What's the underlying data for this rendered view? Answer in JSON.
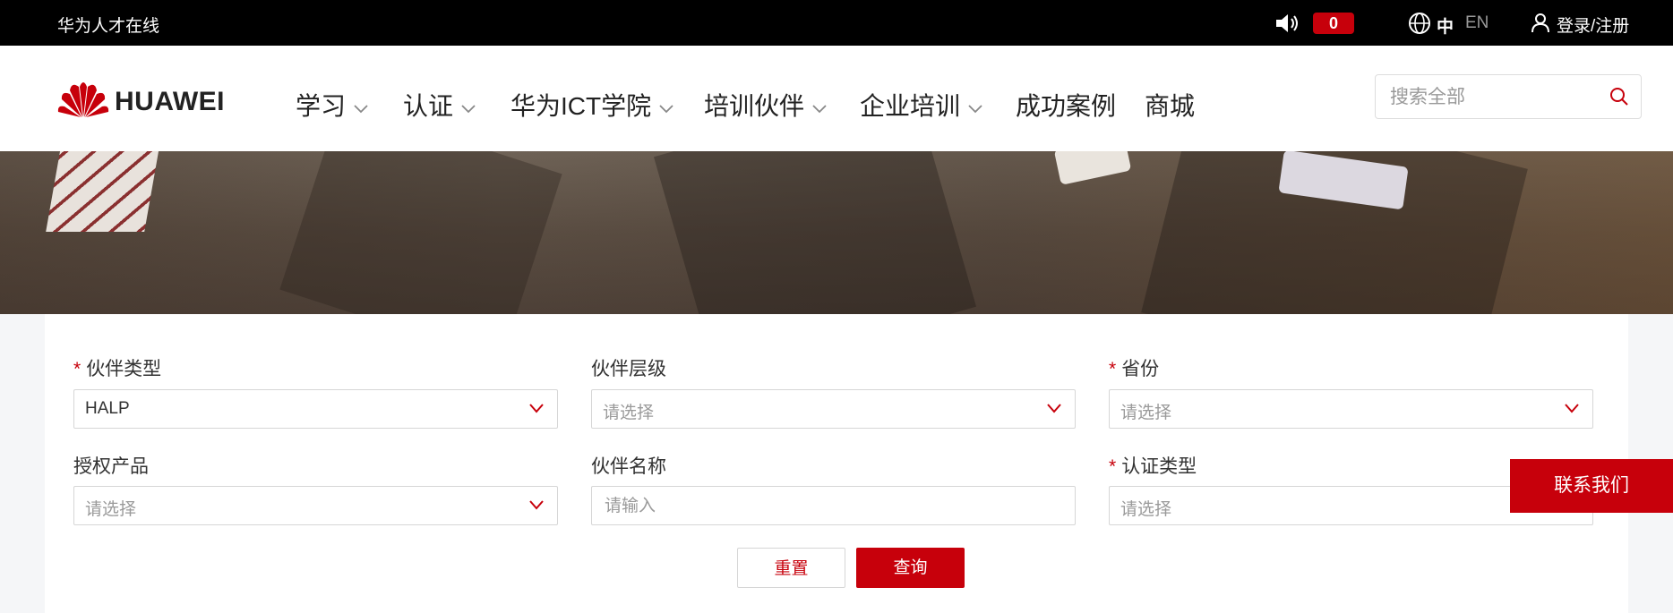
{
  "topbar": {
    "site_name": "华为人才在线",
    "notification_count": "0",
    "lang_zh": "中",
    "lang_en": "EN",
    "login_label": "登录/注册"
  },
  "brand": {
    "logo_text": "HUAWEI",
    "accent_color": "#c7000b"
  },
  "nav": {
    "items": [
      {
        "label": "学习",
        "has_dropdown": true
      },
      {
        "label": "认证",
        "has_dropdown": true
      },
      {
        "label": "华为ICT学院",
        "has_dropdown": true
      },
      {
        "label": "培训伙伴",
        "has_dropdown": true
      },
      {
        "label": "企业培训",
        "has_dropdown": true
      },
      {
        "label": "成功案例",
        "has_dropdown": false
      },
      {
        "label": "商城",
        "has_dropdown": false
      }
    ],
    "search_placeholder": "搜索全部"
  },
  "form": {
    "partner_type": {
      "label": "伙伴类型",
      "required": true,
      "value": "HALP"
    },
    "partner_level": {
      "label": "伙伴层级",
      "required": false,
      "placeholder": "请选择"
    },
    "province": {
      "label": "省份",
      "required": true,
      "placeholder": "请选择"
    },
    "authorized_product": {
      "label": "授权产品",
      "required": false,
      "placeholder": "请选择"
    },
    "partner_name": {
      "label": "伙伴名称",
      "required": false,
      "placeholder": "请输入"
    },
    "cert_type": {
      "label": "认证类型",
      "required": true,
      "placeholder": "请选择"
    },
    "reset_label": "重置",
    "query_label": "查询"
  },
  "contact_label": "联系我们"
}
